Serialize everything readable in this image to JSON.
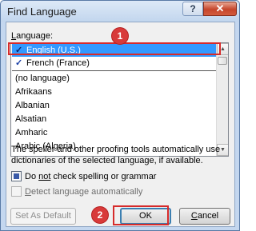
{
  "window": {
    "title": "Find Language",
    "help_label": "?",
    "close_label": "✕"
  },
  "language_label_underlined": "L",
  "language_label_rest": "anguage:",
  "languages": [
    {
      "label": "English (U.S.)",
      "checked": true,
      "selected": true
    },
    {
      "label": "French (France)",
      "checked": true,
      "selected": false
    },
    {
      "label": "(no language)",
      "checked": false,
      "selected": false
    },
    {
      "label": "Afrikaans",
      "checked": false,
      "selected": false
    },
    {
      "label": "Albanian",
      "checked": false,
      "selected": false
    },
    {
      "label": "Alsatian",
      "checked": false,
      "selected": false
    },
    {
      "label": "Amharic",
      "checked": false,
      "selected": false
    },
    {
      "label": "Arabic (Algeria)",
      "checked": false,
      "selected": false
    }
  ],
  "scroll": {
    "up": "▲",
    "down": "▼"
  },
  "info_text": "The speller and other proofing tools automatically use dictionaries of the selected language, if available.",
  "options": {
    "do_not_check_underlined": "not",
    "do_not_check_prefix": "Do ",
    "do_not_check_suffix": " check spelling or grammar",
    "do_not_check_checked": true,
    "detect_underlined": "D",
    "detect_rest": "etect language automatically",
    "detect_enabled": false
  },
  "buttons": {
    "set_default": "Set As Default",
    "ok": "OK",
    "cancel_underlined": "C",
    "cancel_rest": "ancel"
  },
  "annotations": {
    "badge1": "1",
    "badge2": "2",
    "color": "#d62b2b"
  }
}
